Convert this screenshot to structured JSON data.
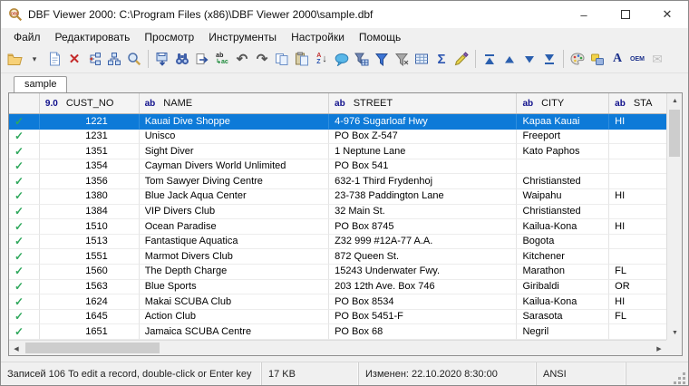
{
  "window": {
    "title": "DBF Viewer 2000: C:\\Program Files (x86)\\DBF Viewer 2000\\sample.dbf",
    "controls": {
      "minimize": "–",
      "close": "✕"
    }
  },
  "menu": {
    "items": [
      {
        "label": "Файл"
      },
      {
        "label": "Редактировать"
      },
      {
        "label": "Просмотр"
      },
      {
        "label": "Инструменты"
      },
      {
        "label": "Настройки"
      },
      {
        "label": "Помощь"
      }
    ]
  },
  "toolbar": {
    "items": [
      {
        "name": "open-file-button",
        "kind": "folder"
      },
      {
        "name": "open-file-dropdown",
        "kind": "glyph",
        "glyph": "▾",
        "color": "#444444",
        "size": 9
      },
      {
        "name": "new-file-button",
        "kind": "page"
      },
      {
        "name": "delete-record-button",
        "kind": "glyph",
        "glyph": "✕",
        "color": "#c42b2b",
        "size": 15,
        "bold": true
      },
      {
        "name": "edit-structure-button",
        "kind": "struct1"
      },
      {
        "name": "field-layout-button",
        "kind": "struct2"
      },
      {
        "name": "zoom-view-button",
        "kind": "magnifier"
      },
      {
        "kind": "sep"
      },
      {
        "name": "export-button",
        "kind": "export"
      },
      {
        "name": "find-button",
        "kind": "binoculars"
      },
      {
        "name": "find-next-button",
        "kind": "findnext"
      },
      {
        "name": "replace-button",
        "kind": "replace"
      },
      {
        "name": "undo-button",
        "kind": "glyph",
        "glyph": "↶",
        "color": "#555555",
        "size": 15,
        "bold": true
      },
      {
        "name": "redo-button",
        "kind": "glyph",
        "glyph": "↷",
        "color": "#555555",
        "size": 15,
        "bold": true
      },
      {
        "name": "copy-button",
        "kind": "copy"
      },
      {
        "name": "paste-button",
        "kind": "paste"
      },
      {
        "name": "sort-button",
        "kind": "sort"
      },
      {
        "name": "memo-button",
        "kind": "bubble"
      },
      {
        "name": "filter-builder-button",
        "kind": "filtergrid"
      },
      {
        "name": "filter-button",
        "kind": "funnel"
      },
      {
        "name": "clear-filter-button",
        "kind": "funnelgray"
      },
      {
        "name": "grid-options-button",
        "kind": "grid"
      },
      {
        "name": "sum-button",
        "kind": "glyph",
        "glyph": "Σ",
        "color": "#2b54b0",
        "size": 15,
        "bold": true
      },
      {
        "name": "format-button",
        "kind": "brush"
      },
      {
        "kind": "sep"
      },
      {
        "name": "first-record-button",
        "kind": "navfirst"
      },
      {
        "name": "prev-record-button",
        "kind": "navprev"
      },
      {
        "name": "next-record-button",
        "kind": "navnext"
      },
      {
        "name": "last-record-button",
        "kind": "navlast"
      },
      {
        "kind": "sep"
      },
      {
        "name": "colors-button",
        "kind": "palette"
      },
      {
        "name": "theme-button",
        "kind": "shapes"
      },
      {
        "name": "font-button",
        "kind": "glyph",
        "glyph": "A",
        "color": "#1a2f8a",
        "size": 14,
        "bold": true,
        "serif": true
      },
      {
        "name": "oem-charset-button",
        "kind": "glyph",
        "glyph": "OEM",
        "color": "#1a2f8a",
        "size": 7,
        "bold": true
      },
      {
        "name": "email-button",
        "kind": "glyph",
        "glyph": "✉",
        "color": "#9a9a9a",
        "size": 14,
        "disabled": true
      }
    ]
  },
  "tabs": [
    {
      "label": "sample",
      "active": true
    }
  ],
  "grid": {
    "columns": [
      {
        "type": "9.0",
        "label": "CUST_NO"
      },
      {
        "type": "ab",
        "label": "NAME"
      },
      {
        "type": "ab",
        "label": "STREET"
      },
      {
        "type": "ab",
        "label": "CITY"
      },
      {
        "type": "ab",
        "label": "STA"
      }
    ],
    "rows": [
      {
        "cust_no": "1221",
        "name": "Kauai Dive Shoppe",
        "street": "4-976 Sugarloaf Hwy",
        "city": "Kapaa Kauai",
        "state": "HI",
        "selected": true
      },
      {
        "cust_no": "1231",
        "name": "Unisco",
        "street": "PO Box Z-547",
        "city": "Freeport",
        "state": ""
      },
      {
        "cust_no": "1351",
        "name": "Sight Diver",
        "street": "1 Neptune Lane",
        "city": "Kato Paphos",
        "state": ""
      },
      {
        "cust_no": "1354",
        "name": "Cayman Divers World Unlimited",
        "street": "PO Box 541",
        "city": "",
        "state": ""
      },
      {
        "cust_no": "1356",
        "name": "Tom Sawyer Diving Centre",
        "street": "632-1 Third Frydenhoj",
        "city": "Christiansted",
        "state": ""
      },
      {
        "cust_no": "1380",
        "name": "Blue Jack Aqua Center",
        "street": "23-738 Paddington Lane",
        "city": "Waipahu",
        "state": "HI"
      },
      {
        "cust_no": "1384",
        "name": "VIP Divers Club",
        "street": "32 Main St.",
        "city": "Christiansted",
        "state": ""
      },
      {
        "cust_no": "1510",
        "name": "Ocean Paradise",
        "street": "PO Box 8745",
        "city": "Kailua-Kona",
        "state": "HI"
      },
      {
        "cust_no": "1513",
        "name": "Fantastique Aquatica",
        "street": "Z32 999 #12A-77 A.A.",
        "city": "Bogota",
        "state": ""
      },
      {
        "cust_no": "1551",
        "name": "Marmot Divers Club",
        "street": "872 Queen St.",
        "city": "Kitchener",
        "state": ""
      },
      {
        "cust_no": "1560",
        "name": "The Depth Charge",
        "street": "15243 Underwater Fwy.",
        "city": "Marathon",
        "state": "FL"
      },
      {
        "cust_no": "1563",
        "name": "Blue Sports",
        "street": "203 12th Ave. Box 746",
        "city": "Giribaldi",
        "state": "OR"
      },
      {
        "cust_no": "1624",
        "name": "Makai SCUBA Club",
        "street": "PO Box 8534",
        "city": "Kailua-Kona",
        "state": "HI"
      },
      {
        "cust_no": "1645",
        "name": "Action Club",
        "street": "PO Box 5451-F",
        "city": "Sarasota",
        "state": "FL"
      },
      {
        "cust_no": "1651",
        "name": "Jamaica SCUBA Centre",
        "street": "PO Box 68",
        "city": "Negril",
        "state": ""
      }
    ]
  },
  "statusbar": {
    "records": "Записей 106 To edit a record, double-click or Enter key",
    "size": "17 KB",
    "modified": "Изменен: 22.10.2020 8:30:00",
    "encoding": "ANSI"
  },
  "colors": {
    "selection": "#0d7ad8",
    "checkmark_green": "#2fa85c",
    "type_label_navy": "#10108c"
  }
}
